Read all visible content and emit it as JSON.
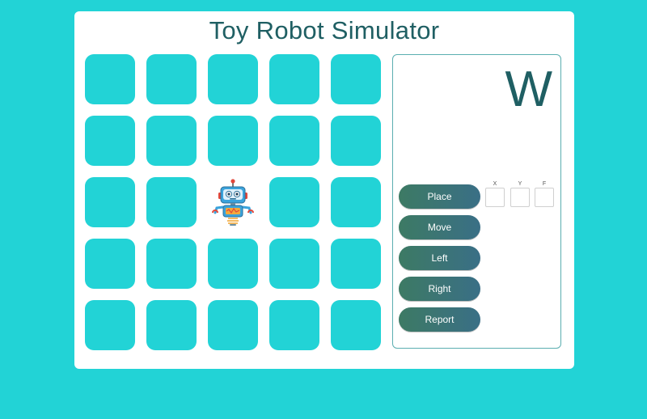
{
  "app": {
    "title": "Toy Robot Simulator"
  },
  "board": {
    "rows": 5,
    "cols": 5,
    "robot_position": {
      "row": 3,
      "col": 3
    }
  },
  "status": {
    "facing": "W"
  },
  "controls": {
    "place_label": "Place",
    "move_label": "Move",
    "left_label": "Left",
    "right_label": "Right",
    "report_label": "Report"
  },
  "inputs": {
    "x_label": "X",
    "y_label": "Y",
    "f_label": "F",
    "x_value": "",
    "y_value": "",
    "f_value": ""
  },
  "colors": {
    "background": "#22d3d6",
    "cell": "#22d3d6",
    "title": "#1f5f63",
    "button_start": "#3d7a64",
    "button_end": "#3a6f86"
  },
  "icons": {
    "robot": "robot-icon"
  }
}
